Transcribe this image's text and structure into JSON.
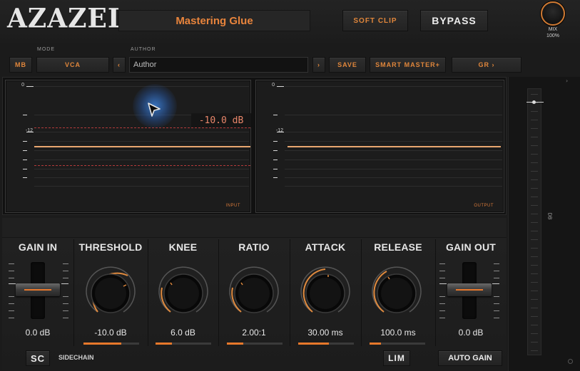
{
  "header": {
    "logo": "AZAZEL",
    "preset_name": "Mastering Glue",
    "soft_clip_label": "SOFT CLIP",
    "bypass_label": "BYPASS",
    "mix_label": "MIX",
    "mix_value": "100%"
  },
  "toolbar": {
    "mode_label": "MODE",
    "author_label": "AUTHOR",
    "mb_label": "MB",
    "mode_value": "VCA",
    "prev_label": "‹",
    "author_value": "Author",
    "author_placeholder": "Author",
    "next_label": "›",
    "save_label": "SAVE",
    "smart_master_label": "SMART MASTER+",
    "gr_label": "GR ›"
  },
  "graphs": {
    "input": {
      "corner_label": "INPUT",
      "tick_top": "0",
      "tick_mid": "-12",
      "threshold_readout": "-10.0 dB"
    },
    "output": {
      "corner_label": "OUTPUT",
      "tick_top": "0",
      "tick_mid": "-12"
    }
  },
  "controls": {
    "gain_in": {
      "title": "GAIN IN",
      "value": "0.0 dB"
    },
    "threshold": {
      "title": "THRESHOLD",
      "value": "-10.0 dB",
      "fill": 0.68
    },
    "knee": {
      "title": "KNEE",
      "value": "6.0 dB",
      "fill": 0.3
    },
    "ratio": {
      "title": "RATIO",
      "value": "2.00:1",
      "fill": 0.3
    },
    "attack": {
      "title": "ATTACK",
      "value": "30.00 ms",
      "fill": 0.55
    },
    "release": {
      "title": "RELEASE",
      "value": "100.0 ms",
      "fill": 0.2
    },
    "gain_out": {
      "title": "GAIN OUT",
      "value": "0.0 dB"
    }
  },
  "bottom": {
    "sc_label": "SC",
    "sidechain_label": "SIDECHAIN",
    "lim_label": "LIM",
    "auto_gain_label": "AUTO GAIN"
  },
  "meter": {
    "unit_label": "DB",
    "top_arrow": "›"
  },
  "colors": {
    "accent": "#e0863b",
    "threshold_line": "#b23a3a",
    "curve": "#e8a770"
  }
}
